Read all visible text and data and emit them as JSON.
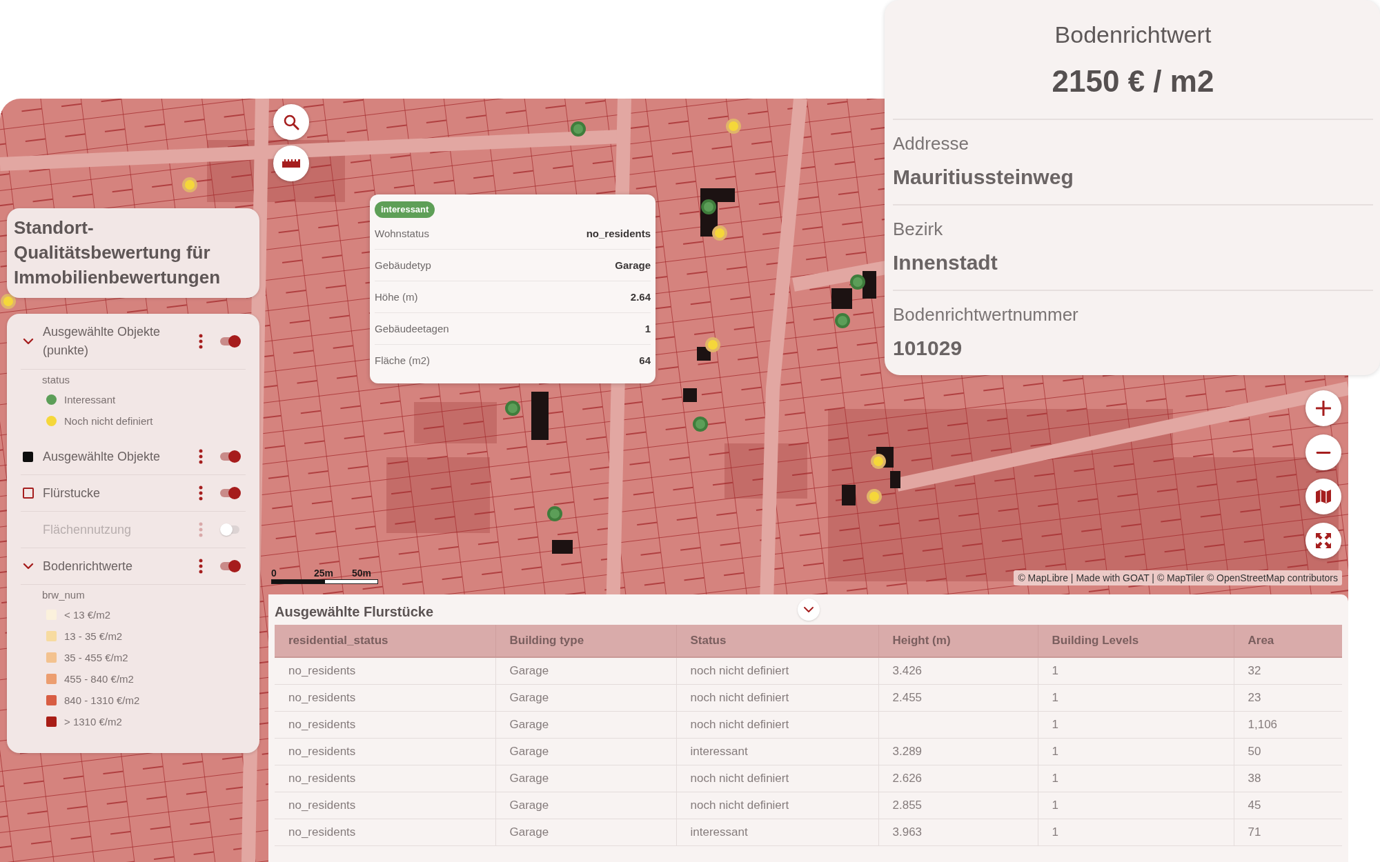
{
  "info_panel": {
    "title": "Bodenrichtwert",
    "value": "2150 € / m2",
    "fields": [
      {
        "label": "Addresse",
        "value": "Mauritiussteinweg"
      },
      {
        "label": "Bezirk",
        "value": "Innenstadt"
      },
      {
        "label": "Bodenrichtwertnummer",
        "value": "101029"
      }
    ]
  },
  "sidebar": {
    "title": "Standort-Qualitätsbewertung für Immobilienbewertungen",
    "layers": [
      {
        "name": "Ausgewählte Objekte (punkte)",
        "kind": "group",
        "expanded": true,
        "on": true,
        "legend_title": "status",
        "legend": [
          {
            "kind": "dot",
            "label": "Interessant",
            "color": "#5c9e58"
          },
          {
            "kind": "dot",
            "label": "Noch nicht definiert",
            "color": "#f5d73a"
          }
        ]
      },
      {
        "name": "Ausgewählte Objekte",
        "kind": "fill",
        "on": true
      },
      {
        "name": "Flürstucke",
        "kind": "outline",
        "on": true
      },
      {
        "name": "Flächennutzung",
        "kind": "plain",
        "on": false
      },
      {
        "name": "Bodenrichtwerte",
        "kind": "group",
        "expanded": true,
        "on": true,
        "legend_title": "brw_num",
        "legend": [
          {
            "kind": "square",
            "label": "< 13 €/m2",
            "color": "#fbf1dc"
          },
          {
            "kind": "square",
            "label": "13 - 35 €/m2",
            "color": "#f7dba0"
          },
          {
            "kind": "square",
            "label": "35 - 455 €/m2",
            "color": "#f3c28f"
          },
          {
            "kind": "square",
            "label": "455 - 840 €/m2",
            "color": "#ec9e70"
          },
          {
            "kind": "square",
            "label": "840 - 1310 €/m2",
            "color": "#d85d43"
          },
          {
            "kind": "square",
            "label": "> 1310 €/m2",
            "color": "#a81d16"
          }
        ]
      }
    ]
  },
  "popup": {
    "badge": "interessant",
    "rows": [
      {
        "label": "Wohnstatus",
        "value": "no_residents"
      },
      {
        "label": "Gebäudetyp",
        "value": "Garage"
      },
      {
        "label": "Höhe (m)",
        "value": "2.64"
      },
      {
        "label": "Gebäudeetagen",
        "value": "1"
      },
      {
        "label": "Fläche (m2)",
        "value": "64"
      }
    ]
  },
  "map": {
    "scale_labels": [
      "0",
      "25m",
      "50m"
    ],
    "attribution": "© MapLibre | Made with GOAT | © MapTiler © OpenStreetMap contributors"
  },
  "table": {
    "title": "Ausgewählte Flurstücke",
    "columns": [
      "residential_status",
      "Building type",
      "Status",
      "Height (m)",
      "Building Levels",
      "Area"
    ],
    "rows": [
      [
        "no_residents",
        "Garage",
        "noch nicht definiert",
        "3.426",
        "1",
        "32"
      ],
      [
        "no_residents",
        "Garage",
        "noch nicht definiert",
        "2.455",
        "1",
        "23"
      ],
      [
        "no_residents",
        "Garage",
        "noch nicht definiert",
        null,
        "1",
        "1,106"
      ],
      [
        "no_residents",
        "Garage",
        "interessant",
        "3.289",
        "1",
        "50"
      ],
      [
        "no_residents",
        "Garage",
        "noch nicht definiert",
        "2.626",
        "1",
        "38"
      ],
      [
        "no_residents",
        "Garage",
        "noch nicht definiert",
        "2.855",
        "1",
        "45"
      ],
      [
        "no_residents",
        "Garage",
        "interessant",
        "3.963",
        "1",
        "71"
      ]
    ]
  }
}
